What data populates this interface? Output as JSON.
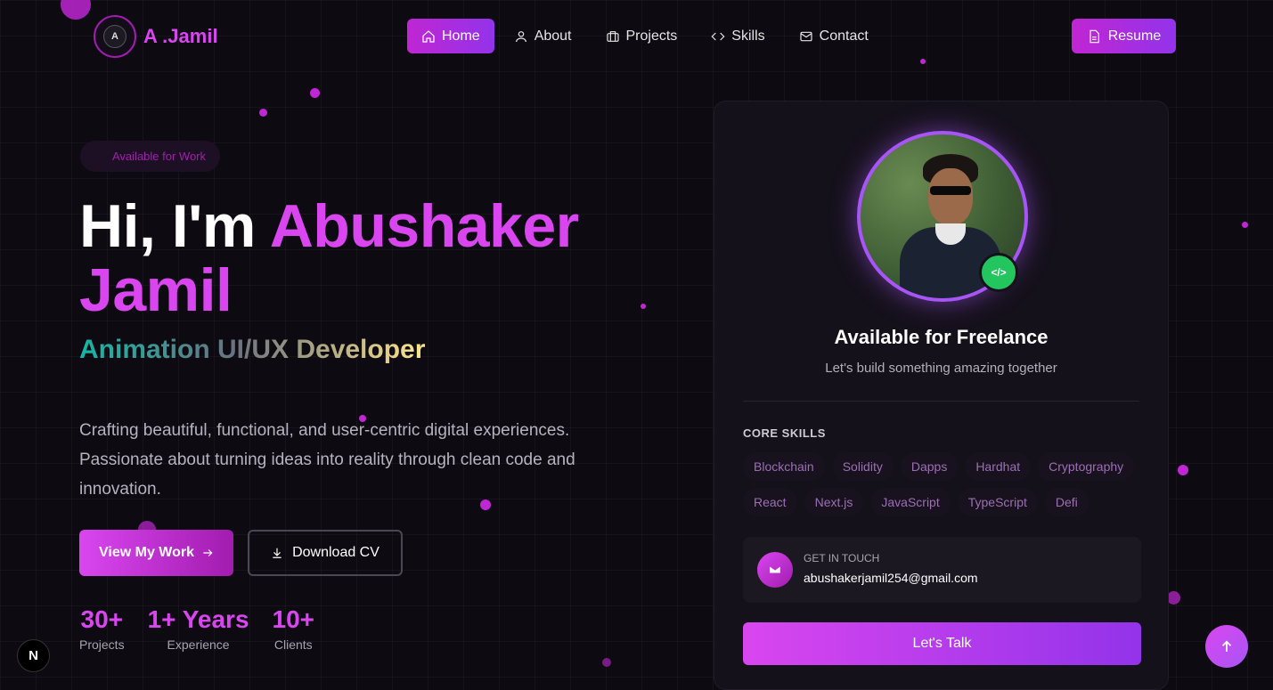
{
  "brand": {
    "logo_mark": "A",
    "name": "A .Jamil"
  },
  "nav": {
    "items": [
      {
        "label": "Home",
        "icon": "home-icon",
        "active": true
      },
      {
        "label": "About",
        "icon": "user-icon"
      },
      {
        "label": "Projects",
        "icon": "briefcase-icon"
      },
      {
        "label": "Skills",
        "icon": "code-icon"
      },
      {
        "label": "Contact",
        "icon": "mail-icon"
      }
    ],
    "resume_label": "Resume"
  },
  "hero": {
    "badge": "Available for Work",
    "greeting": "Hi, I'm",
    "name": "Abushaker Jamil",
    "role": "Animation UI/UX Developer",
    "description": "Crafting beautiful, functional, and user-centric digital experiences. Passionate about turning ideas into reality through clean code and innovation.",
    "primary_button": "View My Work",
    "secondary_button": "Download CV",
    "stats": [
      {
        "value": "30+",
        "label": "Projects"
      },
      {
        "value": "1+ Years",
        "label": "Experience"
      },
      {
        "value": "10+",
        "label": "Clients"
      }
    ]
  },
  "card": {
    "badge_symbol": "</>",
    "title": "Available for Freelance",
    "subtitle": "Let's build something amazing together",
    "skills_heading": "CORE SKILLS",
    "skills": [
      "Blockchain",
      "Solidity",
      "Dapps",
      "Hardhat",
      "Cryptography",
      "React",
      "Next.js",
      "JavaScript",
      "TypeScript",
      "Defi"
    ],
    "contact_label": "GET IN TOUCH",
    "contact_email": "abushakerjamil254@gmail.com",
    "cta": "Let's Talk"
  },
  "floating": {
    "next_badge": "N"
  },
  "colors": {
    "accent": "#d946ef",
    "accent_purple": "#9333ea",
    "background": "#0d0a12",
    "online": "#22c55e"
  }
}
